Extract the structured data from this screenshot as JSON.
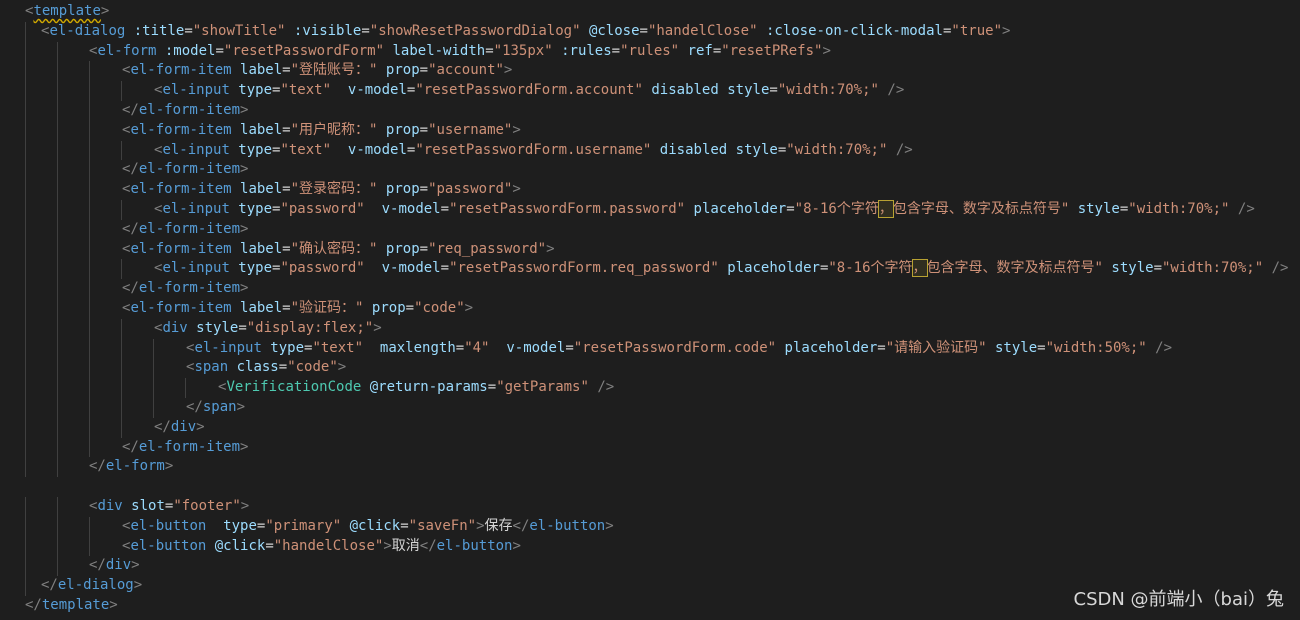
{
  "lines": [
    {
      "i": 0,
      "p": [
        [
          "brk",
          "<"
        ],
        [
          "tag squig",
          "template"
        ],
        [
          "brk",
          ">"
        ]
      ]
    },
    {
      "i": 1,
      "p": [
        [
          "brk",
          "<"
        ],
        [
          "tag",
          "el-dialog "
        ],
        [
          "attr",
          ":title"
        ],
        [
          "txt",
          "="
        ],
        [
          "str",
          "\"showTitle\""
        ],
        [
          "txt",
          " "
        ],
        [
          "attr",
          ":visible"
        ],
        [
          "txt",
          "="
        ],
        [
          "str",
          "\"showResetPasswordDialog\""
        ],
        [
          "txt",
          " "
        ],
        [
          "attr",
          "@close"
        ],
        [
          "txt",
          "="
        ],
        [
          "str",
          "\"handelClose\""
        ],
        [
          "txt",
          " "
        ],
        [
          "attr",
          ":close-on-click-modal"
        ],
        [
          "txt",
          "="
        ],
        [
          "str",
          "\"true\""
        ],
        [
          "brk",
          ">"
        ]
      ]
    },
    {
      "i": 2,
      "p": [
        [
          "brk",
          "<"
        ],
        [
          "tag",
          "el-form "
        ],
        [
          "attr",
          ":model"
        ],
        [
          "txt",
          "="
        ],
        [
          "str",
          "\"resetPasswordForm\""
        ],
        [
          "txt",
          " "
        ],
        [
          "attr",
          "label-width"
        ],
        [
          "txt",
          "="
        ],
        [
          "str",
          "\"135px\""
        ],
        [
          "txt",
          " "
        ],
        [
          "attr",
          ":rules"
        ],
        [
          "txt",
          "="
        ],
        [
          "str",
          "\"rules\""
        ],
        [
          "txt",
          " "
        ],
        [
          "attr",
          "ref"
        ],
        [
          "txt",
          "="
        ],
        [
          "str",
          "\"resetPRefs\""
        ],
        [
          "brk",
          ">"
        ]
      ]
    },
    {
      "i": 3,
      "p": [
        [
          "brk",
          "<"
        ],
        [
          "tag",
          "el-form-item "
        ],
        [
          "attr",
          "label"
        ],
        [
          "txt",
          "="
        ],
        [
          "str",
          "\"登陆账号：\""
        ],
        [
          "txt",
          " "
        ],
        [
          "attr",
          "prop"
        ],
        [
          "txt",
          "="
        ],
        [
          "str",
          "\"account\""
        ],
        [
          "brk",
          ">"
        ]
      ]
    },
    {
      "i": 4,
      "p": [
        [
          "brk",
          "<"
        ],
        [
          "tag",
          "el-input "
        ],
        [
          "attr",
          "type"
        ],
        [
          "txt",
          "="
        ],
        [
          "str",
          "\"text\""
        ],
        [
          "txt",
          "  "
        ],
        [
          "attr",
          "v-model"
        ],
        [
          "txt",
          "="
        ],
        [
          "str",
          "\"resetPasswordForm.account\""
        ],
        [
          "txt",
          " "
        ],
        [
          "attr",
          "disabled"
        ],
        [
          "txt",
          " "
        ],
        [
          "attr",
          "style"
        ],
        [
          "txt",
          "="
        ],
        [
          "str",
          "\"width:70%;\""
        ],
        [
          "txt",
          " "
        ],
        [
          "brk",
          "/>"
        ]
      ]
    },
    {
      "i": 5,
      "p": [
        [
          "brk",
          "</"
        ],
        [
          "tag",
          "el-form-item"
        ],
        [
          "brk",
          ">"
        ]
      ]
    },
    {
      "i": 6,
      "p": [
        [
          "brk",
          "<"
        ],
        [
          "tag",
          "el-form-item "
        ],
        [
          "attr",
          "label"
        ],
        [
          "txt",
          "="
        ],
        [
          "str",
          "\"用户昵称：\""
        ],
        [
          "txt",
          " "
        ],
        [
          "attr",
          "prop"
        ],
        [
          "txt",
          "="
        ],
        [
          "str",
          "\"username\""
        ],
        [
          "brk",
          ">"
        ]
      ]
    },
    {
      "i": 7,
      "p": [
        [
          "brk",
          "<"
        ],
        [
          "tag",
          "el-input "
        ],
        [
          "attr",
          "type"
        ],
        [
          "txt",
          "="
        ],
        [
          "str",
          "\"text\""
        ],
        [
          "txt",
          "  "
        ],
        [
          "attr",
          "v-model"
        ],
        [
          "txt",
          "="
        ],
        [
          "str",
          "\"resetPasswordForm.username\""
        ],
        [
          "txt",
          " "
        ],
        [
          "attr",
          "disabled"
        ],
        [
          "txt",
          " "
        ],
        [
          "attr",
          "style"
        ],
        [
          "txt",
          "="
        ],
        [
          "str",
          "\"width:70%;\""
        ],
        [
          "txt",
          " "
        ],
        [
          "brk",
          "/>"
        ]
      ]
    },
    {
      "i": 8,
      "p": [
        [
          "brk",
          "</"
        ],
        [
          "tag",
          "el-form-item"
        ],
        [
          "brk",
          ">"
        ]
      ]
    },
    {
      "i": 9,
      "p": [
        [
          "brk",
          "<"
        ],
        [
          "tag",
          "el-form-item "
        ],
        [
          "attr",
          "label"
        ],
        [
          "txt",
          "="
        ],
        [
          "str",
          "\"登录密码：\""
        ],
        [
          "txt",
          " "
        ],
        [
          "attr",
          "prop"
        ],
        [
          "txt",
          "="
        ],
        [
          "str",
          "\"password\""
        ],
        [
          "brk",
          ">"
        ]
      ]
    },
    {
      "i": 10,
      "p": [
        [
          "brk",
          "<"
        ],
        [
          "tag",
          "el-input "
        ],
        [
          "attr",
          "type"
        ],
        [
          "txt",
          "="
        ],
        [
          "str",
          "\"password\""
        ],
        [
          "txt",
          "  "
        ],
        [
          "attr",
          "v-model"
        ],
        [
          "txt",
          "="
        ],
        [
          "str",
          "\"resetPasswordForm.password\""
        ],
        [
          "txt",
          " "
        ],
        [
          "attr",
          "placeholder"
        ],
        [
          "txt",
          "="
        ],
        [
          "str",
          "\"8-16个字符"
        ],
        [
          "str hl",
          "，"
        ],
        [
          "str",
          "包含字母、数字及标点符号\""
        ],
        [
          "txt",
          " "
        ],
        [
          "attr",
          "style"
        ],
        [
          "txt",
          "="
        ],
        [
          "str",
          "\"width:70%;\""
        ],
        [
          "txt",
          " "
        ],
        [
          "brk",
          "/>"
        ]
      ]
    },
    {
      "i": 11,
      "p": [
        [
          "brk",
          "</"
        ],
        [
          "tag",
          "el-form-item"
        ],
        [
          "brk",
          ">"
        ]
      ]
    },
    {
      "i": 12,
      "p": [
        [
          "brk",
          "<"
        ],
        [
          "tag",
          "el-form-item "
        ],
        [
          "attr",
          "label"
        ],
        [
          "txt",
          "="
        ],
        [
          "str",
          "\"确认密码：\""
        ],
        [
          "txt",
          " "
        ],
        [
          "attr",
          "prop"
        ],
        [
          "txt",
          "="
        ],
        [
          "str",
          "\"req_password\""
        ],
        [
          "brk",
          ">"
        ]
      ]
    },
    {
      "i": 13,
      "p": [
        [
          "brk",
          "<"
        ],
        [
          "tag",
          "el-input "
        ],
        [
          "attr",
          "type"
        ],
        [
          "txt",
          "="
        ],
        [
          "str",
          "\"password\""
        ],
        [
          "txt",
          "  "
        ],
        [
          "attr",
          "v-model"
        ],
        [
          "txt",
          "="
        ],
        [
          "str",
          "\"resetPasswordForm.req_password\""
        ],
        [
          "txt",
          " "
        ],
        [
          "attr",
          "placeholder"
        ],
        [
          "txt",
          "="
        ],
        [
          "str",
          "\"8-16个字符"
        ],
        [
          "str hl",
          "，"
        ],
        [
          "str",
          "包含字母、数字及标点符号\""
        ],
        [
          "txt",
          " "
        ],
        [
          "attr",
          "style"
        ],
        [
          "txt",
          "="
        ],
        [
          "str",
          "\"width:70%;\""
        ],
        [
          "txt",
          " "
        ],
        [
          "brk",
          "/>"
        ]
      ]
    },
    {
      "i": 14,
      "p": [
        [
          "brk",
          "</"
        ],
        [
          "tag",
          "el-form-item"
        ],
        [
          "brk",
          ">"
        ]
      ]
    },
    {
      "i": 15,
      "p": [
        [
          "brk",
          "<"
        ],
        [
          "tag",
          "el-form-item "
        ],
        [
          "attr",
          "label"
        ],
        [
          "txt",
          "="
        ],
        [
          "str",
          "\"验证码：\""
        ],
        [
          "txt",
          " "
        ],
        [
          "attr",
          "prop"
        ],
        [
          "txt",
          "="
        ],
        [
          "str",
          "\"code\""
        ],
        [
          "brk",
          ">"
        ]
      ]
    },
    {
      "i": 16,
      "p": [
        [
          "brk",
          "<"
        ],
        [
          "tag",
          "div "
        ],
        [
          "attr",
          "style"
        ],
        [
          "txt",
          "="
        ],
        [
          "str",
          "\"display:flex;\""
        ],
        [
          "brk",
          ">"
        ]
      ]
    },
    {
      "i": 17,
      "p": [
        [
          "brk",
          "<"
        ],
        [
          "tag",
          "el-input "
        ],
        [
          "attr",
          "type"
        ],
        [
          "txt",
          "="
        ],
        [
          "str",
          "\"text\""
        ],
        [
          "txt",
          "  "
        ],
        [
          "attr",
          "maxlength"
        ],
        [
          "txt",
          "="
        ],
        [
          "str",
          "\"4\""
        ],
        [
          "txt",
          "  "
        ],
        [
          "attr",
          "v-model"
        ],
        [
          "txt",
          "="
        ],
        [
          "str",
          "\"resetPasswordForm.code\""
        ],
        [
          "txt",
          " "
        ],
        [
          "attr",
          "placeholder"
        ],
        [
          "txt",
          "="
        ],
        [
          "str",
          "\"请输入验证码\""
        ],
        [
          "txt",
          " "
        ],
        [
          "attr",
          "style"
        ],
        [
          "txt",
          "="
        ],
        [
          "str",
          "\"width:50%;\""
        ],
        [
          "txt",
          " "
        ],
        [
          "brk",
          "/>"
        ]
      ]
    },
    {
      "i": 18,
      "p": [
        [
          "brk",
          "<"
        ],
        [
          "tag",
          "span "
        ],
        [
          "attr",
          "class"
        ],
        [
          "txt",
          "="
        ],
        [
          "str",
          "\"code\""
        ],
        [
          "brk",
          ">"
        ]
      ]
    },
    {
      "i": 19,
      "p": [
        [
          "brk",
          "<"
        ],
        [
          "cmp",
          "VerificationCode "
        ],
        [
          "attr",
          "@return-params"
        ],
        [
          "txt",
          "="
        ],
        [
          "str",
          "\"getParams\""
        ],
        [
          "txt",
          " "
        ],
        [
          "brk",
          "/>"
        ]
      ]
    },
    {
      "i": 20,
      "p": [
        [
          "brk",
          "</"
        ],
        [
          "tag",
          "span"
        ],
        [
          "brk",
          ">"
        ]
      ]
    },
    {
      "i": 21,
      "p": [
        [
          "brk",
          "</"
        ],
        [
          "tag",
          "div"
        ],
        [
          "brk",
          ">"
        ]
      ]
    },
    {
      "i": 22,
      "p": [
        [
          "brk",
          "</"
        ],
        [
          "tag",
          "el-form-item"
        ],
        [
          "brk",
          ">"
        ]
      ]
    },
    {
      "i": 23,
      "p": [
        [
          "brk",
          "</"
        ],
        [
          "tag",
          "el-form"
        ],
        [
          "brk",
          ">"
        ]
      ]
    },
    {
      "i": 24,
      "p": []
    },
    {
      "i": 25,
      "p": [
        [
          "brk",
          "<"
        ],
        [
          "tag",
          "div "
        ],
        [
          "attr",
          "slot"
        ],
        [
          "txt",
          "="
        ],
        [
          "str",
          "\"footer\""
        ],
        [
          "brk",
          ">"
        ]
      ]
    },
    {
      "i": 26,
      "p": [
        [
          "brk",
          "<"
        ],
        [
          "tag",
          "el-button "
        ],
        [
          "txt",
          " "
        ],
        [
          "attr",
          "type"
        ],
        [
          "txt",
          "="
        ],
        [
          "str",
          "\"primary\""
        ],
        [
          "txt",
          " "
        ],
        [
          "attr",
          "@click"
        ],
        [
          "txt",
          "="
        ],
        [
          "str",
          "\"saveFn\""
        ],
        [
          "brk",
          ">"
        ],
        [
          "txt",
          "保存"
        ],
        [
          "brk",
          "</"
        ],
        [
          "tag",
          "el-button"
        ],
        [
          "brk",
          ">"
        ]
      ]
    },
    {
      "i": 27,
      "p": [
        [
          "brk",
          "<"
        ],
        [
          "tag",
          "el-button "
        ],
        [
          "attr",
          "@click"
        ],
        [
          "txt",
          "="
        ],
        [
          "str",
          "\"handelClose\""
        ],
        [
          "brk",
          ">"
        ],
        [
          "txt",
          "取消"
        ],
        [
          "brk",
          "</"
        ],
        [
          "tag",
          "el-button"
        ],
        [
          "brk",
          ">"
        ]
      ]
    },
    {
      "i": 28,
      "p": [
        [
          "brk",
          "</"
        ],
        [
          "tag",
          "div"
        ],
        [
          "brk",
          ">"
        ]
      ]
    },
    {
      "i": 29,
      "p": [
        [
          "brk",
          "</"
        ],
        [
          "tag",
          "el-dialog"
        ],
        [
          "brk",
          ">"
        ]
      ]
    },
    {
      "i": 30,
      "p": [
        [
          "brk",
          "</"
        ],
        [
          "tag",
          "template"
        ],
        [
          "brk",
          ">"
        ]
      ]
    }
  ],
  "watermark": "CSDN @前端小（bai）兔"
}
